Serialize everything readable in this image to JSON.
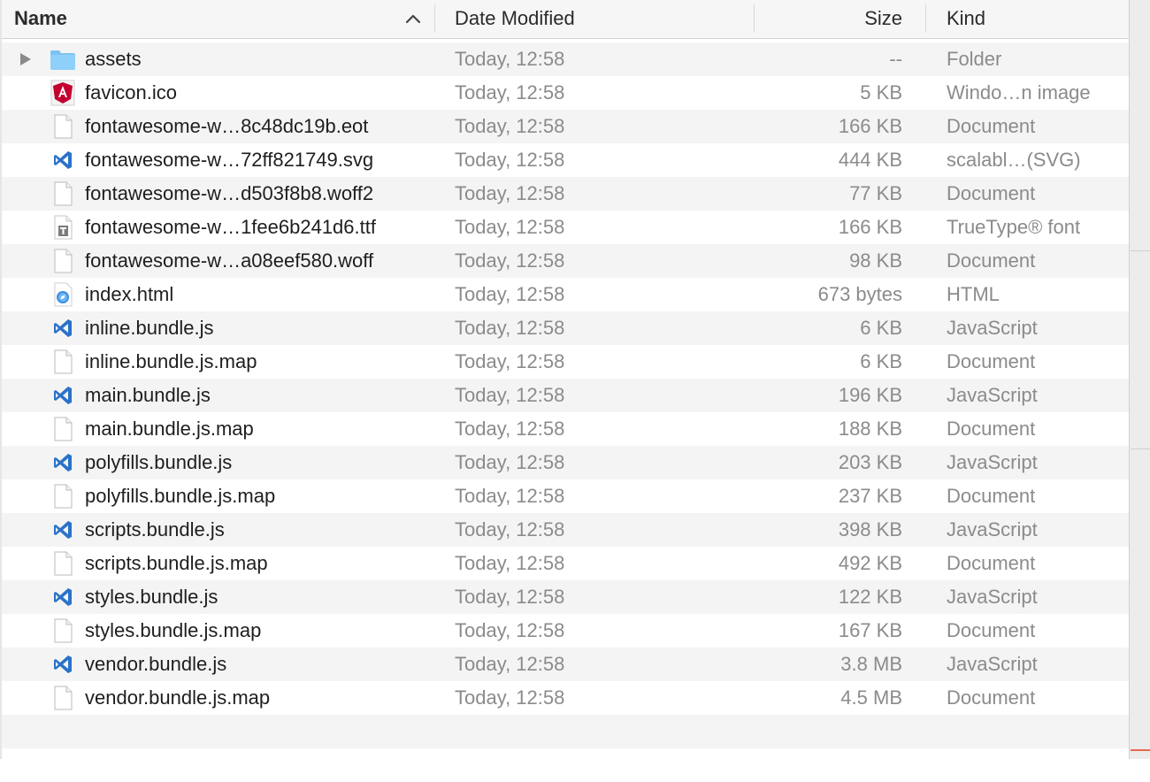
{
  "header": {
    "name_label": "Name",
    "date_label": "Date Modified",
    "size_label": "Size",
    "kind_label": "Kind",
    "sort_icon": "chevron-up-icon"
  },
  "colors": {
    "folder_blue": "#7cc3f3",
    "angular_red": "#c3002f",
    "vscode_blue": "#2a72c9"
  },
  "files": [
    {
      "name": "assets",
      "date": "Today, 12:58",
      "size": "--",
      "kind": "Folder",
      "icon": "folder-icon",
      "expandable": true
    },
    {
      "name": "favicon.ico",
      "date": "Today, 12:58",
      "size": "5 KB",
      "kind": "Windo…n image",
      "icon": "angular-icon"
    },
    {
      "name": "fontawesome-w…8c48dc19b.eot",
      "date": "Today, 12:58",
      "size": "166 KB",
      "kind": "Document",
      "icon": "document-icon"
    },
    {
      "name": "fontawesome-w…72ff821749.svg",
      "date": "Today, 12:58",
      "size": "444 KB",
      "kind": "scalabl…(SVG)",
      "icon": "vscode-icon"
    },
    {
      "name": "fontawesome-w…d503f8b8.woff2",
      "date": "Today, 12:58",
      "size": "77 KB",
      "kind": "Document",
      "icon": "document-icon"
    },
    {
      "name": "fontawesome-w…1fee6b241d6.ttf",
      "date": "Today, 12:58",
      "size": "166 KB",
      "kind": "TrueType® font",
      "icon": "font-file-icon"
    },
    {
      "name": "fontawesome-w…a08eef580.woff",
      "date": "Today, 12:58",
      "size": "98 KB",
      "kind": "Document",
      "icon": "document-icon"
    },
    {
      "name": "index.html",
      "date": "Today, 12:58",
      "size": "673 bytes",
      "kind": "HTML",
      "icon": "safari-icon"
    },
    {
      "name": "inline.bundle.js",
      "date": "Today, 12:58",
      "size": "6 KB",
      "kind": "JavaScript",
      "icon": "vscode-icon"
    },
    {
      "name": "inline.bundle.js.map",
      "date": "Today, 12:58",
      "size": "6 KB",
      "kind": "Document",
      "icon": "document-icon"
    },
    {
      "name": "main.bundle.js",
      "date": "Today, 12:58",
      "size": "196 KB",
      "kind": "JavaScript",
      "icon": "vscode-icon"
    },
    {
      "name": "main.bundle.js.map",
      "date": "Today, 12:58",
      "size": "188 KB",
      "kind": "Document",
      "icon": "document-icon"
    },
    {
      "name": "polyfills.bundle.js",
      "date": "Today, 12:58",
      "size": "203 KB",
      "kind": "JavaScript",
      "icon": "vscode-icon"
    },
    {
      "name": "polyfills.bundle.js.map",
      "date": "Today, 12:58",
      "size": "237 KB",
      "kind": "Document",
      "icon": "document-icon"
    },
    {
      "name": "scripts.bundle.js",
      "date": "Today, 12:58",
      "size": "398 KB",
      "kind": "JavaScript",
      "icon": "vscode-icon"
    },
    {
      "name": "scripts.bundle.js.map",
      "date": "Today, 12:58",
      "size": "492 KB",
      "kind": "Document",
      "icon": "document-icon"
    },
    {
      "name": "styles.bundle.js",
      "date": "Today, 12:58",
      "size": "122 KB",
      "kind": "JavaScript",
      "icon": "vscode-icon"
    },
    {
      "name": "styles.bundle.js.map",
      "date": "Today, 12:58",
      "size": "167 KB",
      "kind": "Document",
      "icon": "document-icon"
    },
    {
      "name": "vendor.bundle.js",
      "date": "Today, 12:58",
      "size": "3.8 MB",
      "kind": "JavaScript",
      "icon": "vscode-icon"
    },
    {
      "name": "vendor.bundle.js.map",
      "date": "Today, 12:58",
      "size": "4.5 MB",
      "kind": "Document",
      "icon": "document-icon"
    }
  ]
}
